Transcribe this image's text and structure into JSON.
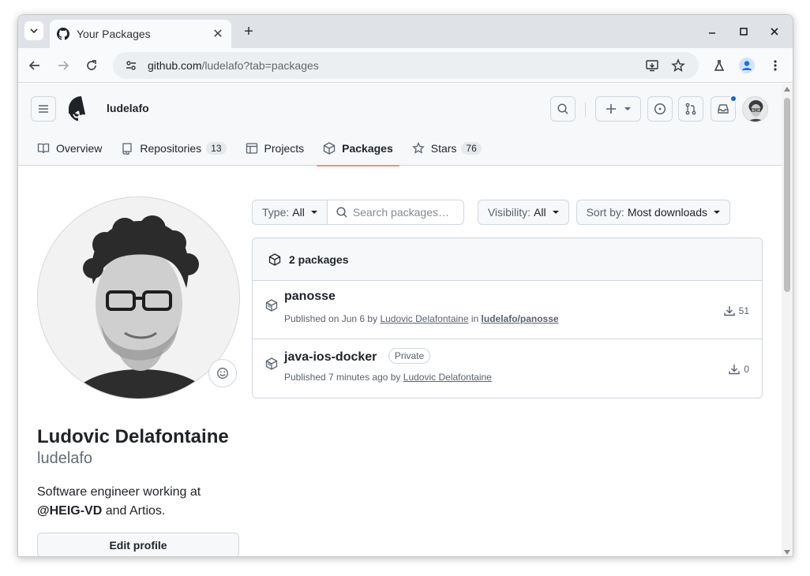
{
  "browser": {
    "tab_title": "Your Packages",
    "url_host": "github.com",
    "url_path": "/ludelafo?tab=packages"
  },
  "header": {
    "username": "ludelafo"
  },
  "nav": {
    "items": [
      {
        "label": "Overview",
        "count": null
      },
      {
        "label": "Repositories",
        "count": "13"
      },
      {
        "label": "Projects",
        "count": null
      },
      {
        "label": "Packages",
        "count": null
      },
      {
        "label": "Stars",
        "count": "76"
      }
    ],
    "active": "Packages"
  },
  "profile": {
    "full_name": "Ludovic Delafontaine",
    "login": "ludelafo",
    "bio_prefix": "Software engineer working at",
    "bio_org": "@HEIG-VD",
    "bio_suffix": "and Artios.",
    "edit_label": "Edit profile"
  },
  "filters": {
    "type_label": "Type:",
    "type_value": "All",
    "search_placeholder": "Search packages…",
    "visibility_label": "Visibility:",
    "visibility_value": "All",
    "sort_label": "Sort by:",
    "sort_value": "Most downloads"
  },
  "packages": {
    "summary": "2 packages",
    "items": [
      {
        "name": "panosse",
        "badge": "",
        "meta_prefix": "Published on Jun 6 by",
        "author": "Ludovic Delafontaine",
        "meta_in": "in",
        "repo": "ludelafo/panosse",
        "downloads": "51"
      },
      {
        "name": "java-ios-docker",
        "badge": "Private",
        "meta_prefix": "Published 7 minutes ago by",
        "author": "Ludovic Delafontaine",
        "meta_in": "",
        "repo": "",
        "downloads": "0"
      }
    ]
  },
  "colors": {
    "accent_underline": "#fd8c73",
    "notification": "#0969da",
    "border": "#d0d7de"
  }
}
